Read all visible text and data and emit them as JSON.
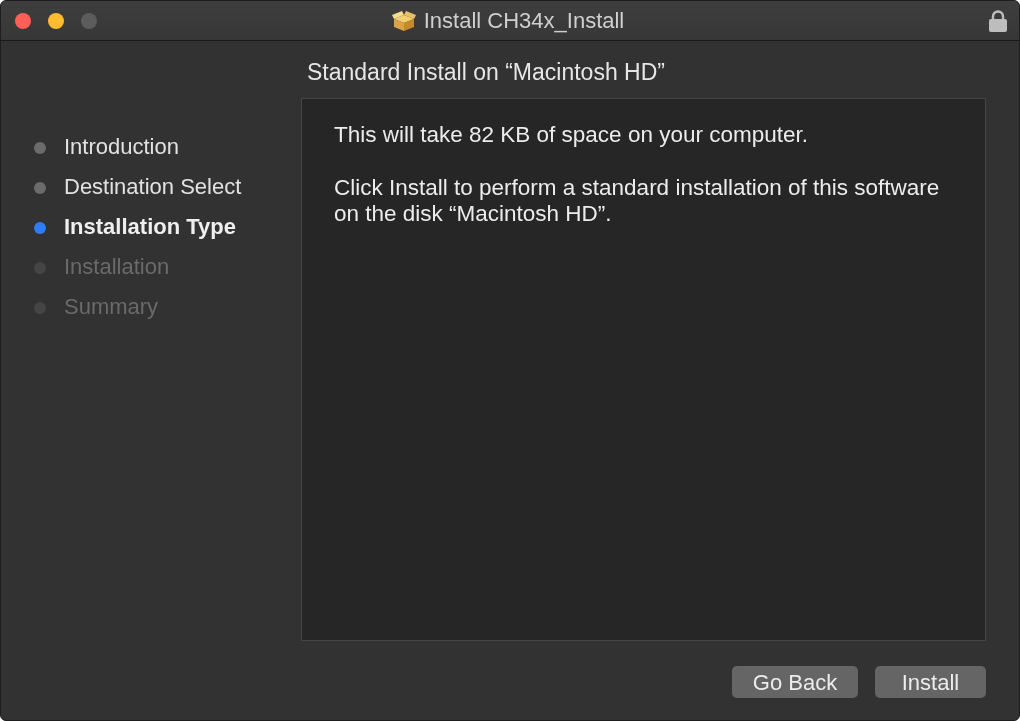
{
  "window": {
    "title": "Install CH34x_Install",
    "controls": [
      {
        "kind": "close",
        "disabled": false
      },
      {
        "kind": "minimize",
        "disabled": false
      },
      {
        "kind": "zoom",
        "disabled": true
      }
    ]
  },
  "steps": [
    {
      "label": "Introduction",
      "selected": false,
      "disabled": false
    },
    {
      "label": "Destination Select",
      "selected": false,
      "disabled": false
    },
    {
      "label": "Installation Type",
      "selected": true,
      "disabled": false
    },
    {
      "label": "Installation",
      "selected": false,
      "disabled": true
    },
    {
      "label": "Summary",
      "selected": false,
      "disabled": true
    }
  ],
  "content": {
    "heading": "Standard Install on “Macintosh HD”",
    "paragraphs": [
      "This will take 82 KB of space on your computer.",
      "Click Install to perform a standard installation of this software on the disk “Macintosh HD”."
    ]
  },
  "buttons": [
    {
      "label": "Go Back"
    },
    {
      "label": "Install"
    }
  ]
}
